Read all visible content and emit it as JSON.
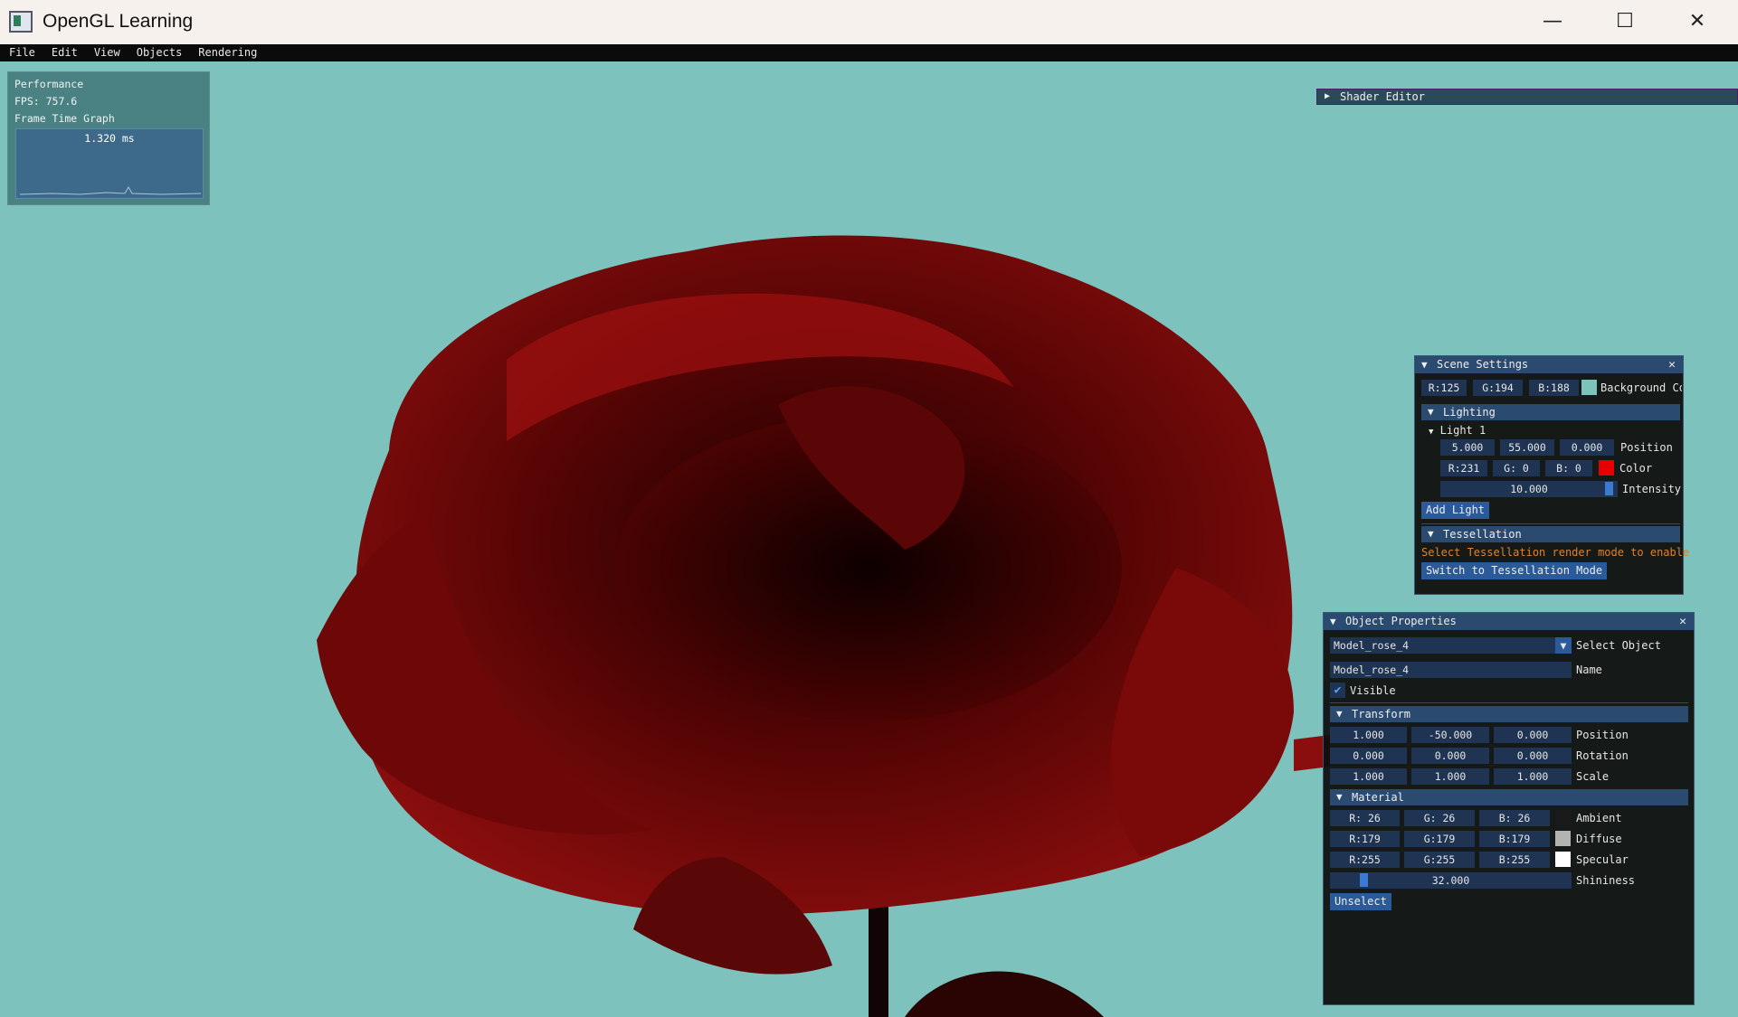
{
  "window": {
    "title": "OpenGL Learning",
    "minimize": "—",
    "maximize": "☐",
    "close": "✕"
  },
  "menu": [
    "File",
    "Edit",
    "View",
    "Objects",
    "Rendering"
  ],
  "performance": {
    "title": "Performance",
    "fps": "FPS: 757.6",
    "graph_title": "Frame Time Graph",
    "frame_time": "1.320 ms"
  },
  "shader_editor": {
    "title": "Shader Editor"
  },
  "scene_settings": {
    "title": "Scene Settings",
    "background": {
      "r": "R:125",
      "g": "G:194",
      "b": "B:188",
      "label": "Background Co",
      "color": "#7dc2bc"
    },
    "lighting": {
      "title": "Lighting",
      "light_title": "Light 1",
      "position": [
        "5.000",
        "55.000",
        "0.000"
      ],
      "position_label": "Position",
      "color": {
        "r": "R:231",
        "g": "G:  0",
        "b": "B:  0",
        "label": "Color",
        "swatch": "#e70000"
      },
      "intensity": "10.000",
      "intensity_label": "Intensity",
      "add_light": "Add Light"
    },
    "tessellation": {
      "title": "Tessellation",
      "warning": "Select Tessellation render mode to enable",
      "switch_button": "Switch to Tessellation Mode"
    }
  },
  "object_properties": {
    "title": "Object Properties",
    "select_value": "Model_rose_4",
    "select_label": "Select Object",
    "name_value": "Model_rose_4",
    "name_label": "Name",
    "visible_label": "Visible",
    "transform": {
      "title": "Transform",
      "position": [
        "1.000",
        "-50.000",
        "0.000"
      ],
      "position_label": "Position",
      "rotation": [
        "0.000",
        "0.000",
        "0.000"
      ],
      "rotation_label": "Rotation",
      "scale": [
        "1.000",
        "1.000",
        "1.000"
      ],
      "scale_label": "Scale"
    },
    "material": {
      "title": "Material",
      "ambient": {
        "r": "R: 26",
        "g": "G: 26",
        "b": "B: 26",
        "label": "Ambient",
        "swatch": "#1a1a1a"
      },
      "diffuse": {
        "r": "R:179",
        "g": "G:179",
        "b": "B:179",
        "label": "Diffuse",
        "swatch": "#b3b3b3"
      },
      "specular": {
        "r": "R:255",
        "g": "G:255",
        "b": "B:255",
        "label": "Specular",
        "swatch": "#ffffff"
      },
      "shininess": "32.000",
      "shininess_label": "Shininess"
    },
    "unselect": "Unselect"
  }
}
